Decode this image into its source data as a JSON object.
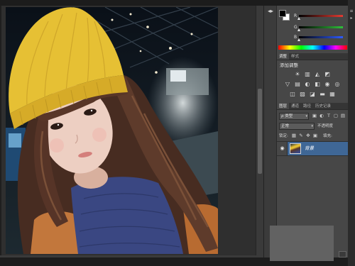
{
  "color_panel": {
    "foreground_color": "#000000",
    "background_color": "#ffffff",
    "channels": [
      {
        "label": "R",
        "color": "#e23b32",
        "level": 0.0
      },
      {
        "label": "G",
        "color": "#2fbf3a",
        "level": 0.0
      },
      {
        "label": "B",
        "color": "#2e5bff",
        "level": 0.0
      }
    ]
  },
  "adjustments": {
    "tabs": [
      "调整",
      "样式"
    ],
    "title": "添加调整",
    "icon_rows": [
      [
        "brightness-contrast-icon",
        "levels-icon",
        "curves-icon",
        "exposure-icon"
      ],
      [
        "vibrance-icon",
        "hue-saturation-icon",
        "color-balance-icon",
        "black-white-icon",
        "photo-filter-icon",
        "channel-mixer-icon"
      ],
      [
        "invert-icon",
        "posterize-icon",
        "threshold-icon",
        "gradient-map-icon",
        "selective-color-icon"
      ]
    ]
  },
  "layers": {
    "tabs": [
      "图层",
      "通道",
      "路径",
      "历史记录"
    ],
    "filter_label": "ρ 类型",
    "filter_icons": [
      "pixel-layer-filter-icon",
      "adjustment-layer-filter-icon",
      "type-layer-filter-icon",
      "shape-layer-filter-icon",
      "smart-object-filter-icon"
    ],
    "blend_mode": "正常",
    "opacity_label": "不透明度",
    "lock_label": "锁定:",
    "lock_icons": [
      "lock-transparent-icon",
      "lock-image-icon",
      "lock-position-icon",
      "lock-all-icon"
    ],
    "fill_label": "填充:",
    "items": [
      {
        "name": "背景",
        "visible": true,
        "selected": true
      }
    ]
  },
  "theme": {
    "panel_bg": "#474747",
    "selection": "#3f6796"
  }
}
